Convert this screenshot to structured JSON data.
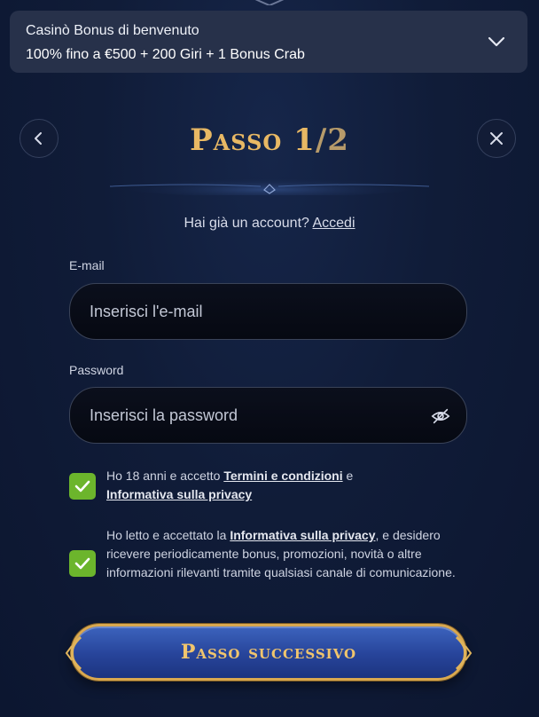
{
  "bonus": {
    "title": "Casinò Bonus di benvenuto",
    "offer": "100% fino a €500 + 200 Giri + 1 Bonus Crab"
  },
  "header": {
    "step_word": "Passo",
    "step_current": "1",
    "step_separator": "/",
    "step_total": "2"
  },
  "account": {
    "prompt": "Hai già un account?",
    "login_link": "Accedi"
  },
  "form": {
    "email_label": "E-mail",
    "email_placeholder": "Inserisci l'e-mail",
    "email_value": "",
    "password_label": "Password",
    "password_placeholder": "Inserisci la password",
    "password_value": ""
  },
  "consents": [
    {
      "checked": true,
      "text_before": "Ho 18 anni e accetto ",
      "link1": "Termini e condizioni",
      "text_middle": " e ",
      "link2": "Informativa sulla privacy",
      "text_after": ""
    },
    {
      "checked": true,
      "text_before": "Ho letto e accettato la ",
      "link1": "Informativa sulla privacy",
      "text_after": ", e desidero ricevere periodicamente bonus, promozioni, novità o altre informazioni rilevanti tramite qualsiasi canale di comunicazione."
    }
  ],
  "next_button": {
    "label": "Passo successivo"
  },
  "icons": {
    "chevron": "chevron-down-icon",
    "back": "chevron-left-icon",
    "close": "close-icon",
    "eye": "eye-off-icon",
    "check": "check-icon"
  },
  "colors": {
    "background": "#101c38",
    "panel": "#27314a",
    "gold": "#e8b864",
    "check_green": "#6cb52c",
    "button_blue": "#27449a"
  }
}
